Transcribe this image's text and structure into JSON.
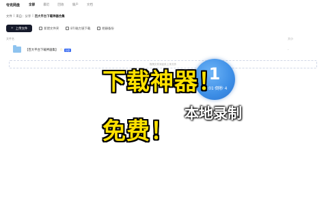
{
  "app": {
    "logo": "夸克网盘"
  },
  "nav": {
    "items": [
      "全部",
      "最近",
      "回收",
      "僵户",
      "文档"
    ],
    "active_index": 0
  },
  "breadcrumb": [
    "文件",
    "来自：分享",
    "百大平台下载神器合集"
  ],
  "toolbar": {
    "upload_label": "上传文件",
    "new_folder_label": "新建文件夹",
    "offline_label": "BT/磁力链下载",
    "backup_label": "相册备份"
  },
  "table": {
    "col_name": "文件名",
    "col_size": "大小",
    "rows": [
      {
        "name": "【百大平台下载神器集】",
        "tag": "分享",
        "size": "-"
      }
    ]
  },
  "dropzone": {
    "text": "拖拽文件到此处上传文件"
  },
  "overlay": {
    "line1": "下载神器！",
    "line2": "免费！",
    "recording_label": "本地录制"
  },
  "recorder": {
    "count": "1",
    "time": "00:01·倒秒 4"
  }
}
